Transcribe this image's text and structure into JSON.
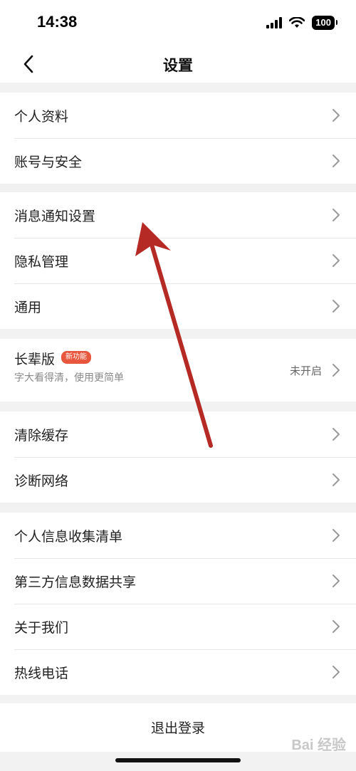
{
  "status_bar": {
    "time": "14:38",
    "battery": "100"
  },
  "nav": {
    "title": "设置"
  },
  "groups": [
    {
      "items": [
        {
          "label": "个人资料"
        },
        {
          "label": "账号与安全"
        }
      ]
    },
    {
      "items": [
        {
          "label": "消息通知设置"
        },
        {
          "label": "隐私管理"
        },
        {
          "label": "通用"
        }
      ]
    },
    {
      "items": [
        {
          "label": "长辈版",
          "badge": "新功能",
          "subtitle": "字大看得清，使用更简单",
          "value": "未开启"
        }
      ]
    },
    {
      "items": [
        {
          "label": "清除缓存"
        },
        {
          "label": "诊断网络"
        }
      ]
    },
    {
      "items": [
        {
          "label": "个人信息收集清单"
        },
        {
          "label": "第三方信息数据共享"
        },
        {
          "label": "关于我们"
        },
        {
          "label": "热线电话"
        }
      ]
    }
  ],
  "logout": {
    "label": "退出登录"
  },
  "watermark": "Bai 经验",
  "colors": {
    "annotation_arrow": "#b52a24",
    "badge": "#e8563d"
  },
  "icons": {
    "back": "chevron-left-icon",
    "row": "chevron-right-icon"
  }
}
